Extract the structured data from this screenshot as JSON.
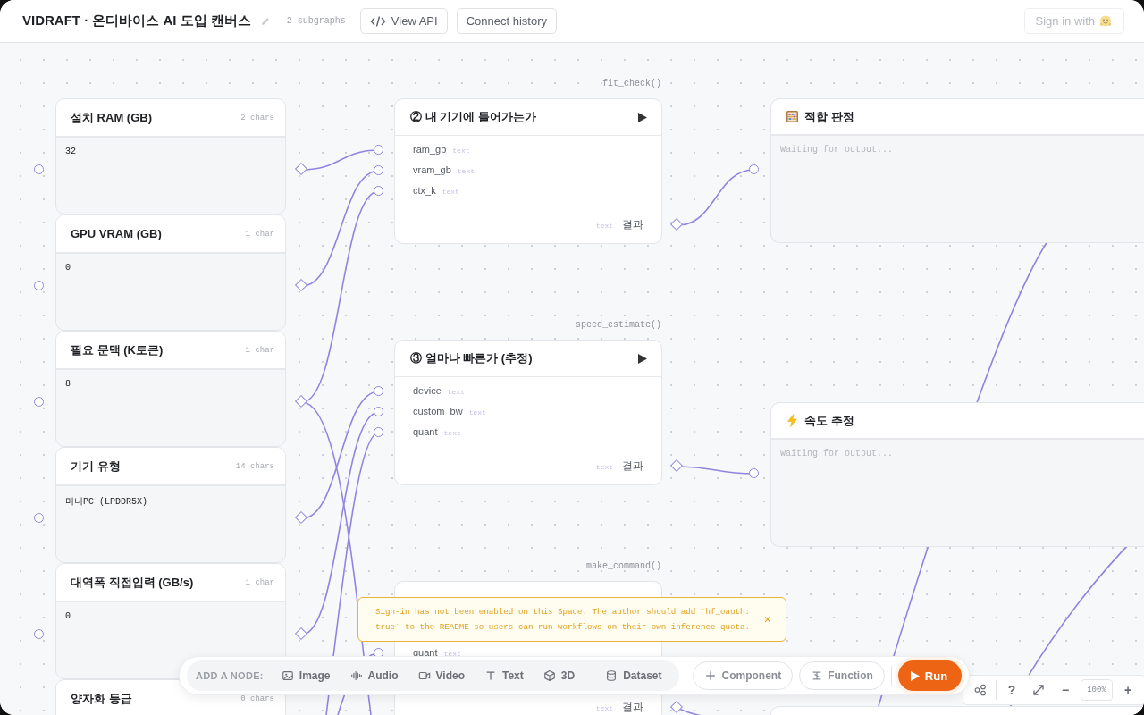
{
  "header": {
    "title": "VIDRAFT · 온디바이스 AI 도입 캔버스",
    "subgraphs": "2 subgraphs",
    "buttons": [
      {
        "label": "View API",
        "kind": "api"
      },
      {
        "label": "Connect history",
        "kind": "plain"
      }
    ],
    "sign_in": {
      "label": "Sign in with",
      "disabled": true
    }
  },
  "input_nodes": [
    {
      "label": "설치 RAM (GB)",
      "count": "2 chars",
      "value": "32"
    },
    {
      "label": "GPU VRAM (GB)",
      "count": "1 char",
      "value": "0"
    },
    {
      "label": "필요 문맥 (K토큰)",
      "count": "1 char",
      "value": "8"
    },
    {
      "label": "기기 유형",
      "count": "14 chars",
      "value": "미니PC (LPDDR5X)"
    },
    {
      "label": "대역폭 직접입력 (GB/s)",
      "count": "1 char",
      "value": "0"
    },
    {
      "label": "양자화 등급",
      "count": "0 chars"
    }
  ],
  "function_nodes": [
    {
      "fn": "fit_check()",
      "title": "② 내 기기에 들어가는가",
      "inputs": [
        {
          "name": "ram_gb",
          "type": "text"
        },
        {
          "name": "vram_gb",
          "type": "text"
        },
        {
          "name": "ctx_k",
          "type": "text"
        }
      ],
      "output_type": "text",
      "output": "결과"
    },
    {
      "fn": "speed_estimate()",
      "title": "③ 얼마나 빠른가 (추정)",
      "inputs": [
        {
          "name": "device",
          "type": "text"
        },
        {
          "name": "custom_bw",
          "type": "text"
        },
        {
          "name": "quant",
          "type": "text"
        }
      ],
      "output_type": "text",
      "output": "결과"
    },
    {
      "fn": "make_command()",
      "inputs": [
        {
          "name": "quant",
          "type": "text"
        }
      ],
      "output_type": "text",
      "output": "결과"
    }
  ],
  "output_nodes": [
    {
      "kind": "fit",
      "title": "적합 판정",
      "placeholder": "Waiting for output..."
    },
    {
      "kind": "speed",
      "title": "속도 추정",
      "placeholder": "Waiting for output..."
    },
    {
      "kind": "blank"
    }
  ],
  "toast": {
    "message": "Sign-in has not been enabled on this Space. The author should add `hf_oauth: true` to the README so users can run workflows on their own inference quota.",
    "close": "×"
  },
  "toolbar": {
    "label": "ADD A NODE:",
    "node_types": [
      {
        "label": "Image",
        "kind": "image"
      },
      {
        "label": "Audio",
        "kind": "audio"
      },
      {
        "label": "Video",
        "kind": "video"
      },
      {
        "label": "Text",
        "kind": "text"
      },
      {
        "label": "3D",
        "kind": "cube"
      },
      {
        "label": "Dataset",
        "kind": "dataset"
      }
    ],
    "actions": [
      {
        "label": "Component",
        "kind": "component"
      },
      {
        "label": "Function",
        "kind": "function"
      }
    ],
    "run": "Run"
  },
  "zoom_controls": {
    "help": "?",
    "minus": "−",
    "zoom": "100%",
    "plus": "+"
  }
}
